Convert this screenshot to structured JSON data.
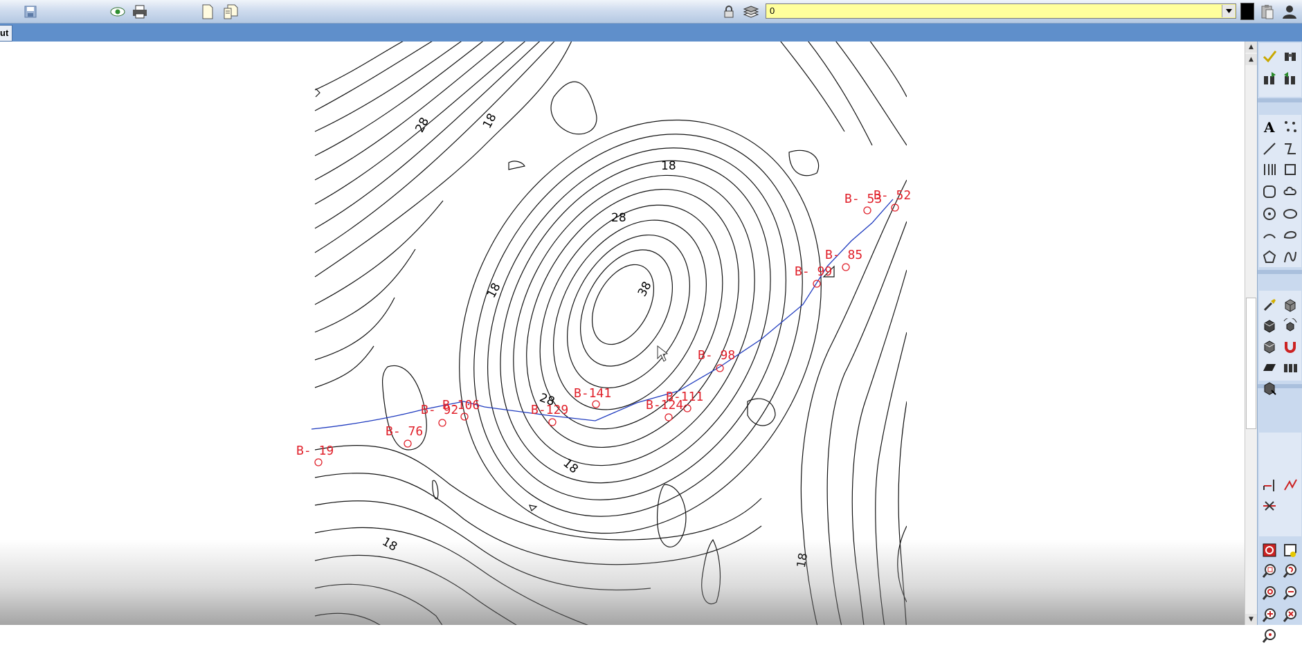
{
  "toolbar": {
    "layer_value": "0",
    "icons": [
      "save-icon",
      "visibility-icon",
      "print-icon",
      "new-document-icon",
      "document-properties-icon",
      "lock-icon",
      "layers-icon",
      "color-swatch-icon",
      "paste-icon",
      "user-icon"
    ]
  },
  "tabbar": {
    "tab_label": "ut"
  },
  "drawing": {
    "borehole_labels": [
      {
        "id": "b53",
        "text": "B- 53"
      },
      {
        "id": "b52",
        "text": "B- 52"
      },
      {
        "id": "b85",
        "text": "B- 85"
      },
      {
        "id": "b99",
        "text": "B- 99"
      },
      {
        "id": "b98",
        "text": "B- 98"
      },
      {
        "id": "b141",
        "text": "B-141"
      },
      {
        "id": "b111",
        "text": "B-111"
      },
      {
        "id": "b124",
        "text": "B-124"
      },
      {
        "id": "b129",
        "text": "B-129"
      },
      {
        "id": "b106",
        "text": "B-106"
      },
      {
        "id": "b92",
        "text": "B- 92"
      },
      {
        "id": "b76",
        "text": "B- 76"
      },
      {
        "id": "b19",
        "text": "B- 19"
      }
    ],
    "contour_labels": [
      "28",
      "18",
      "18",
      "28",
      "18",
      "38",
      "28",
      "18",
      "18",
      "18"
    ]
  },
  "right_panel": {
    "icons": [
      "check-icon",
      "binoculars-icon",
      "find-next-icon",
      "find-prev-icon",
      "text-icon",
      "points-icon",
      "line-icon",
      "polyline-icon",
      "dimension-icon",
      "rectangle-icon",
      "rounded-rect-icon",
      "cloud-icon",
      "circle-icon",
      "ellipse-icon",
      "arc-icon",
      "spline-icon",
      "polygon-icon",
      "curve-icon",
      "brush-icon",
      "cube-icon",
      "cube-icon",
      "cube-rotate-icon",
      "cube-icon",
      "magnet-icon",
      "parallelogram-icon",
      "wall-icon",
      "move-icon",
      "extend-icon",
      "trim-icon",
      "cut-icon",
      "refresh-icon",
      "pan-icon",
      "zoom-window-icon",
      "zoom-extents-icon",
      "zoom-realtime-icon",
      "zoom-out-icon",
      "zoom-in-icon",
      "zoom-cancel-icon",
      "zoom-point-icon"
    ]
  },
  "colors": {
    "label": "#e0202a",
    "path": "#1f3bbf",
    "layer_combo": "#ffff9c"
  }
}
